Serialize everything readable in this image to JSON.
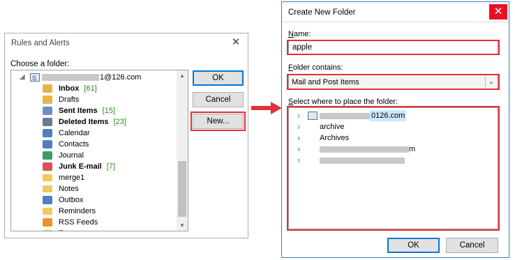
{
  "rules_dialog": {
    "title": "Rules and Alerts",
    "close_glyph": "✕",
    "choose_label": "Choose a folder:",
    "account_suffix": "1@126.com",
    "folders": [
      {
        "label": "Inbox",
        "count": "[61]",
        "bold": true,
        "icon": "inbox-icon"
      },
      {
        "label": "Drafts",
        "count": "",
        "bold": false,
        "icon": "drafts-icon"
      },
      {
        "label": "Sent Items",
        "count": "[15]",
        "bold": true,
        "icon": "sent-icon"
      },
      {
        "label": "Deleted Items",
        "count": "[23]",
        "bold": true,
        "icon": "deleted-icon"
      },
      {
        "label": "Calendar",
        "count": "",
        "bold": false,
        "icon": "calendar-icon"
      },
      {
        "label": "Contacts",
        "count": "",
        "bold": false,
        "icon": "contacts-icon"
      },
      {
        "label": "Journal",
        "count": "",
        "bold": false,
        "icon": "journal-icon"
      },
      {
        "label": "Junk E-mail",
        "count": "[7]",
        "bold": true,
        "icon": "junk-icon"
      },
      {
        "label": "merge1",
        "count": "",
        "bold": false,
        "icon": "folder-icon"
      },
      {
        "label": "Notes",
        "count": "",
        "bold": false,
        "icon": "folder-icon"
      },
      {
        "label": "Outbox",
        "count": "",
        "bold": false,
        "icon": "outbox-icon"
      },
      {
        "label": "Reminders",
        "count": "",
        "bold": false,
        "icon": "folder-icon"
      },
      {
        "label": "RSS Feeds",
        "count": "",
        "bold": false,
        "icon": "rss-icon"
      },
      {
        "label": "Ta...",
        "count": "",
        "bold": false,
        "icon": "folder-icon"
      }
    ],
    "ok_label": "OK",
    "cancel_label": "Cancel",
    "new_label": "New..."
  },
  "create_dialog": {
    "title": "Create New Folder",
    "close_glyph": "✕",
    "name_label_u": "N",
    "name_label_rest": "ame:",
    "name_value": "apple",
    "contains_label_u": "F",
    "contains_label_rest": "older contains:",
    "contains_value": "Mail and Post Items",
    "place_label_u": "S",
    "place_label_rest": "elect where to place the folder:",
    "tree": [
      {
        "label": "0126.com",
        "icon": "account-icon",
        "redacted": true
      },
      {
        "label": "archive",
        "icon": "archive-icon",
        "redacted": false
      },
      {
        "label": "Archives",
        "icon": "",
        "redacted": false
      },
      {
        "label": "m",
        "icon": "",
        "redacted": true
      },
      {
        "label": "",
        "icon": "",
        "redacted": true
      }
    ],
    "ok_label": "OK",
    "cancel_label": "Cancel"
  },
  "colors": {
    "highlight": "#e0303a",
    "accent": "#0078d7"
  }
}
